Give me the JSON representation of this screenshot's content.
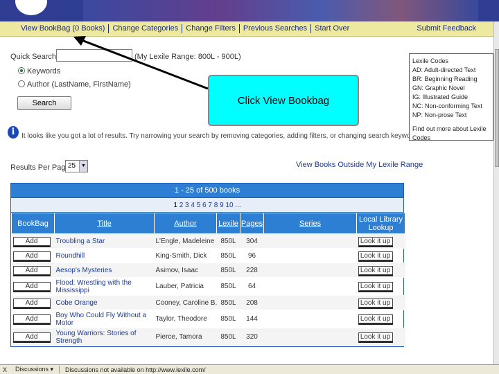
{
  "navbar": {
    "items": [
      "View BookBag (0 Books)",
      "Change Categories",
      "Change Filters",
      "Previous Searches",
      "Start Over"
    ],
    "feedback": "Submit Feedback"
  },
  "search": {
    "label": "Quick Search:",
    "value": "",
    "lexile_range": "(My Lexile Range: 800L - 900L)",
    "option_keywords": "Keywords",
    "option_author": "Author (LastName, FirstName)",
    "button": "Search"
  },
  "hint": "It looks like you got a lot of results. Try narrowing your search by removing categories, adding filters, or changing search keywords above.",
  "lexile_codes": {
    "title": "Lexile Codes",
    "codes": [
      "AD: Adult-directed Text",
      "BR: Beginning Reading",
      "GN: Graphic Novel",
      "IG: Illustrated Guide",
      "NC: Non-conforming Text",
      "NP: Non-prose Text"
    ],
    "more": "Find out more about Lexile Codes"
  },
  "results_per_page": {
    "label": "Results Per Page",
    "value": "25"
  },
  "outside_link": "View Books Outside My Lexile Range",
  "results": {
    "summary": "1 - 25 of 500 books",
    "pages": {
      "current": "1",
      "others": "2 3 4 5 6 7 8 9 10 ..."
    },
    "columns": [
      "BookBag",
      "Title",
      "Author",
      "Lexile",
      "Pages",
      "Series",
      "Local Library Lookup"
    ],
    "add_label": "Add",
    "lookup_label": "Look it up",
    "rows": [
      {
        "title": "Troubling a Star",
        "author": "L'Engle, Madeleine",
        "lexile": "850L",
        "pages": "304"
      },
      {
        "title": "Roundhill",
        "author": "King-Smith, Dick",
        "lexile": "850L",
        "pages": "96"
      },
      {
        "title": "Aesop's Mysteries",
        "author": "Asimov, Isaac",
        "lexile": "850L",
        "pages": "228"
      },
      {
        "title": "Flood: Wrestling with the Mississippi",
        "author": "Lauber, Patricia",
        "lexile": "850L",
        "pages": "64"
      },
      {
        "title": "Cobe Orange",
        "author": "Cooney, Caroline B.",
        "lexile": "850L",
        "pages": "208"
      },
      {
        "title": "Boy Who Could Fly Without a Motor",
        "author": "Taylor, Theodore",
        "lexile": "850L",
        "pages": "144"
      },
      {
        "title": "Young Warriors: Stories of Strength",
        "author": "Pierce, Tamora",
        "lexile": "850L",
        "pages": "320"
      }
    ]
  },
  "callout": "Click View Bookbag",
  "statusbar": {
    "close": "X",
    "discussions": "Discussions ▾",
    "message": "Discussions not available on http://www.lexile.com/"
  }
}
